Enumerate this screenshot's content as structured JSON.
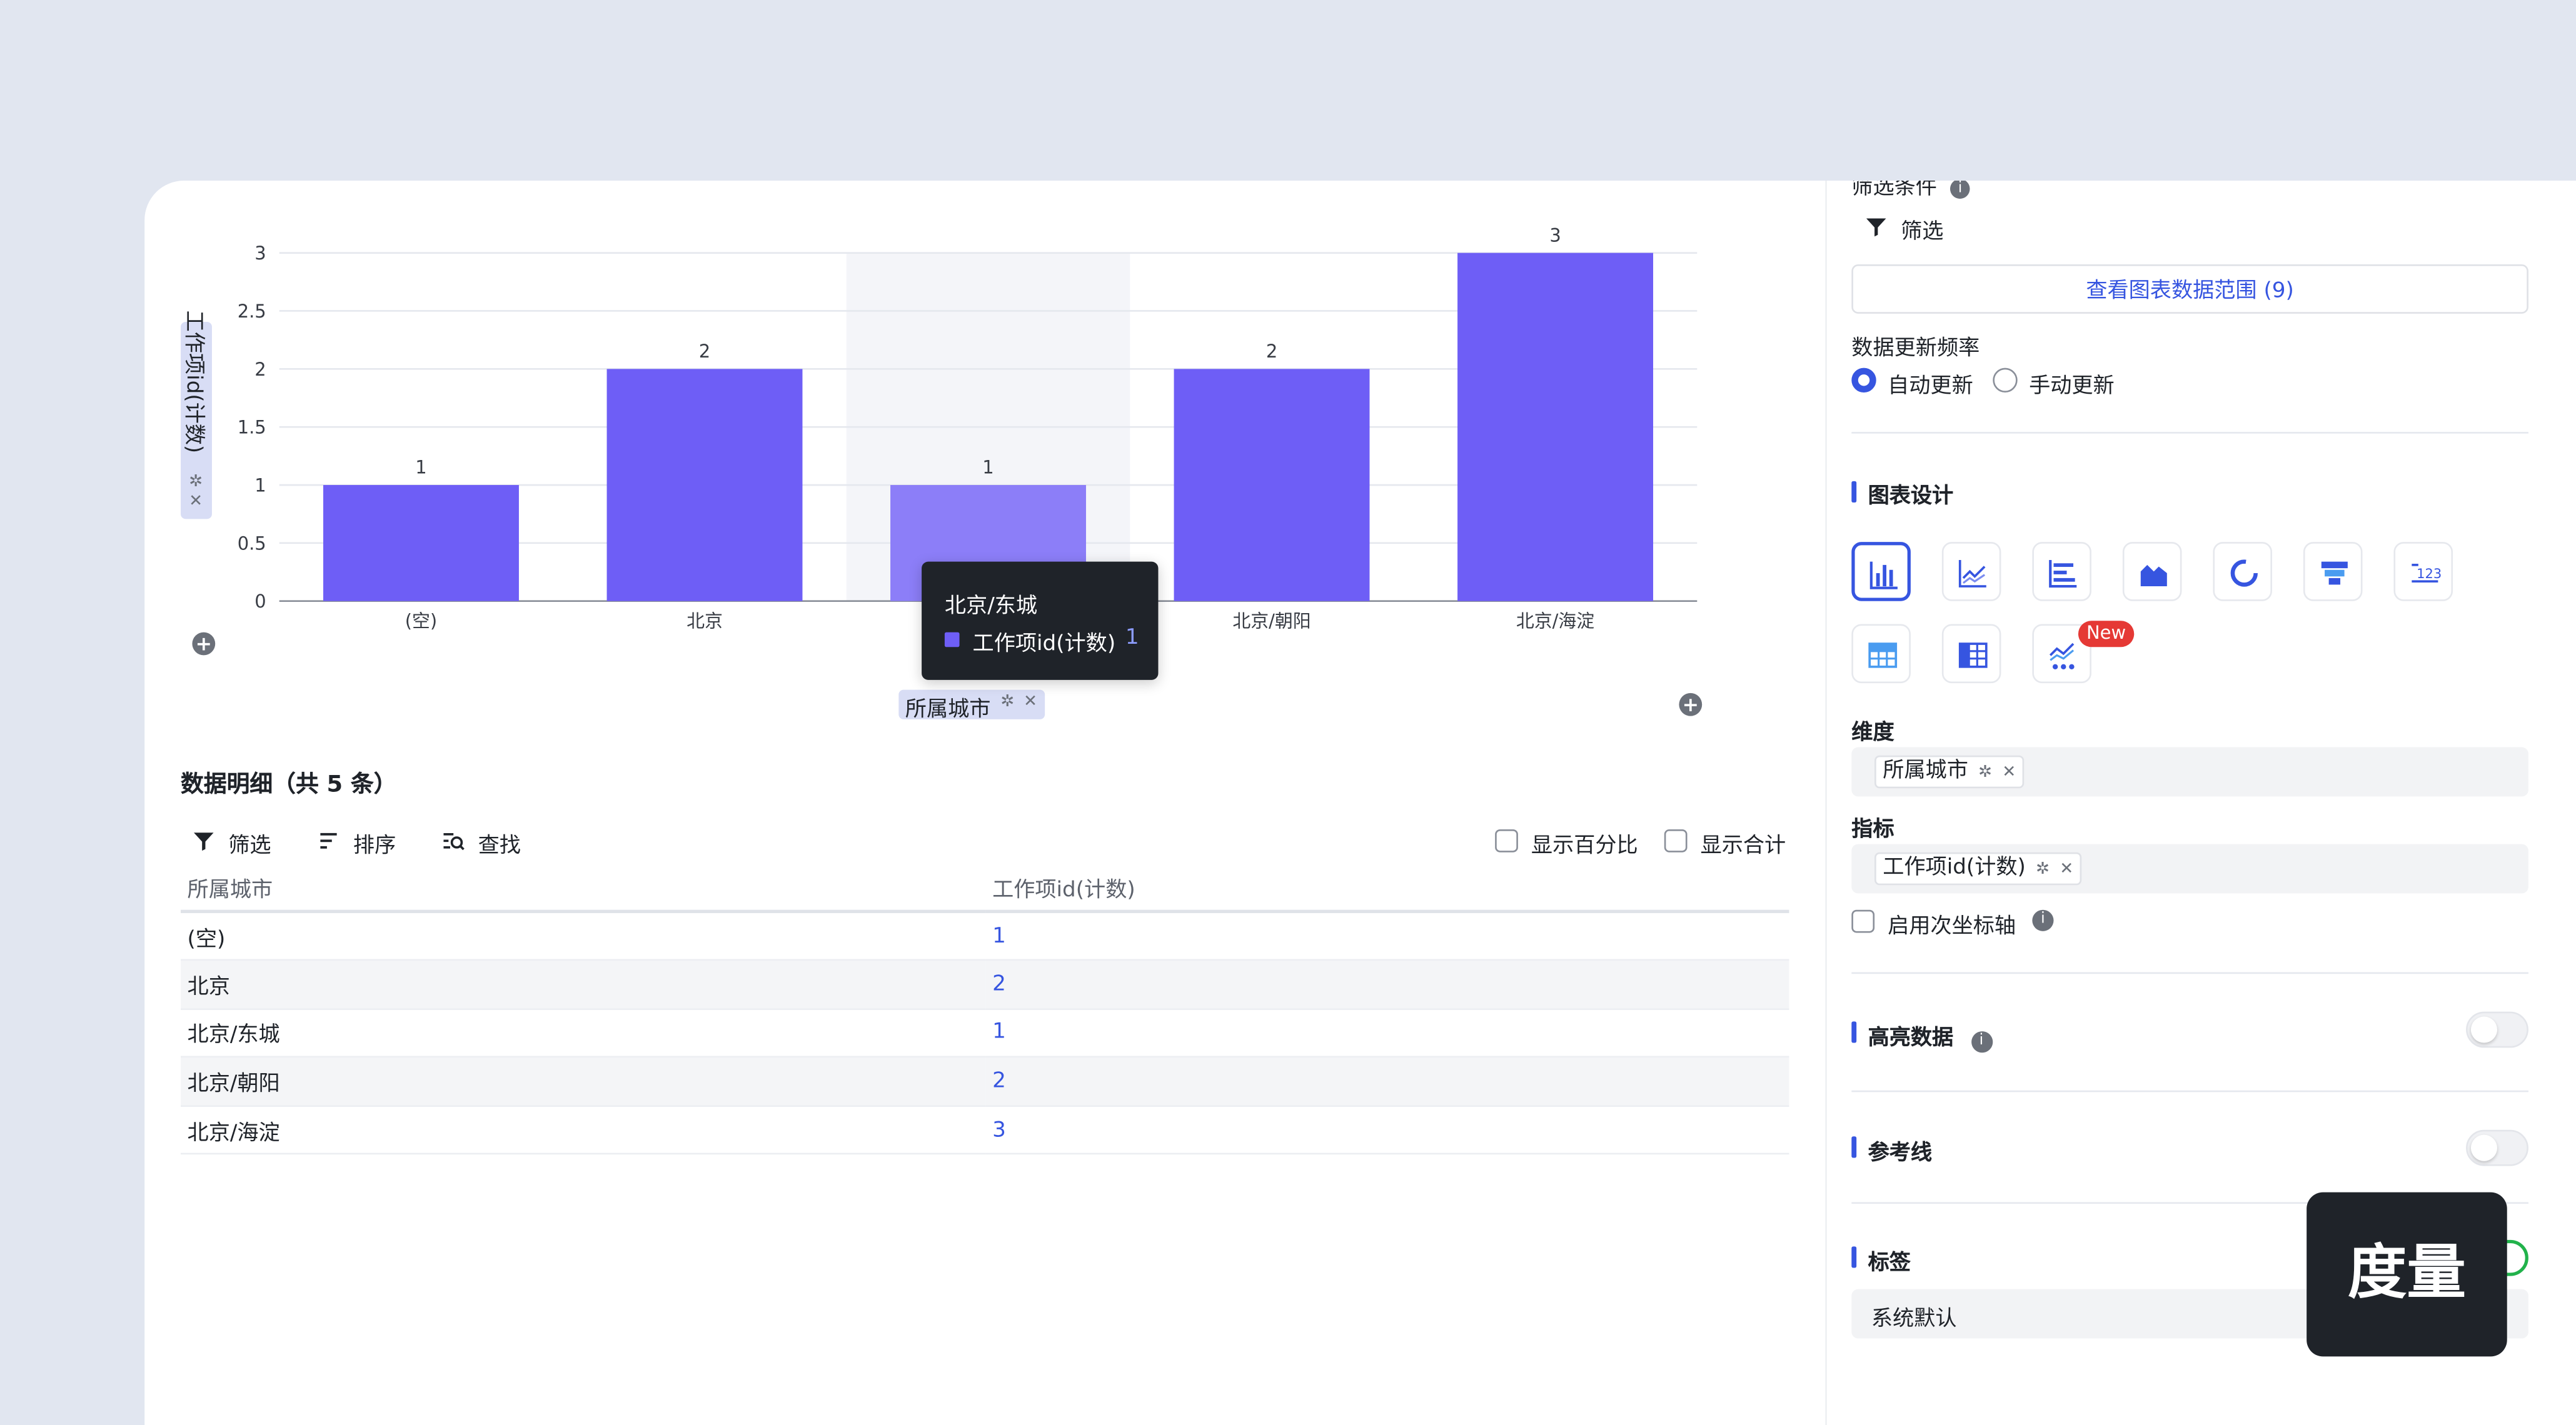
{
  "chart_data": {
    "type": "bar",
    "categories": [
      "(空)",
      "北京",
      "北京/东城",
      "北京/朝阳",
      "北京/海淀"
    ],
    "series": [
      {
        "name": "工作项id(计数)",
        "values": [
          1,
          2,
          1,
          2,
          3
        ]
      }
    ],
    "visible_x_tick_labels": [
      "(空)",
      "北京",
      "北京/朝阳",
      "北京/海淀"
    ],
    "y_ticks": [
      "0",
      "0.5",
      "1",
      "1.5",
      "2",
      "2.5",
      "3"
    ],
    "ylim": [
      0,
      3
    ],
    "grid": true,
    "highlighted_category": "北京/东城",
    "bar_color": "#6e5ef6",
    "highlight_bar_color": "#8c7ef8"
  },
  "chart": {
    "y_axis_field": "工作项id(计数)",
    "x_axis_field": "所属城市",
    "tooltip": {
      "title": "北京/东城",
      "series_name": "工作项id(计数)",
      "value": "1"
    }
  },
  "details": {
    "title": "数据明细（共 5 条）",
    "toolbar": {
      "filter": "筛选",
      "sort": "排序",
      "find": "查找",
      "show_percent": "显示百分比",
      "show_total": "显示合计"
    },
    "columns": [
      "所属城市",
      "工作项id(计数)"
    ],
    "rows": [
      {
        "city": "(空)",
        "count": "1"
      },
      {
        "city": "北京",
        "count": "2"
      },
      {
        "city": "北京/东城",
        "count": "1"
      },
      {
        "city": "北京/朝阳",
        "count": "2"
      },
      {
        "city": "北京/海淀",
        "count": "3"
      }
    ]
  },
  "panel": {
    "filter_conditions": "筛选条件",
    "filter": "筛选",
    "view_range": "查看图表数据范围 (9)",
    "update_freq": "数据更新频率",
    "auto_update": "自动更新",
    "manual_update": "手动更新",
    "chart_design": "图表设计",
    "new_badge": "New",
    "dimension_label": "维度",
    "dimension_value": "所属城市",
    "measure_label": "指标",
    "measure_value": "工作项id(计数)",
    "secondary_axis": "启用次坐标轴",
    "highlight_data": "高亮数据",
    "reference_line": "参考线",
    "labels": "标签",
    "label_value": "系统默认"
  },
  "overlay": {
    "metric_label": "度量"
  },
  "colors": {
    "accent": "#3655e0",
    "bar": "#6e5ef6",
    "background": "#e1e6f0"
  }
}
